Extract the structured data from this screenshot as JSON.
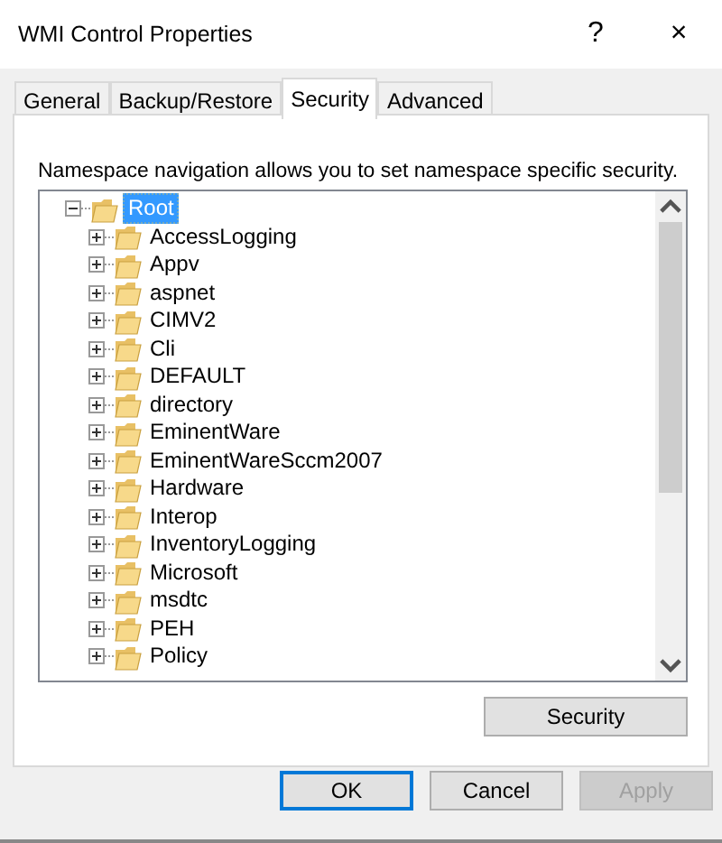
{
  "window": {
    "title": "WMI Control Properties",
    "help": "?",
    "close": "×"
  },
  "tabs": [
    {
      "label": "General",
      "selected": false
    },
    {
      "label": "Backup/Restore",
      "selected": false
    },
    {
      "label": "Security",
      "selected": true
    },
    {
      "label": "Advanced",
      "selected": false
    }
  ],
  "description": "Namespace navigation allows you to set namespace specific security.",
  "tree": {
    "label": "Root",
    "selected": true,
    "expanded": true,
    "children": [
      {
        "label": "AccessLogging",
        "selected": false,
        "expanded": false
      },
      {
        "label": "Appv",
        "selected": false,
        "expanded": false
      },
      {
        "label": "aspnet",
        "selected": false,
        "expanded": false
      },
      {
        "label": "CIMV2",
        "selected": false,
        "expanded": false
      },
      {
        "label": "Cli",
        "selected": false,
        "expanded": false
      },
      {
        "label": "DEFAULT",
        "selected": false,
        "expanded": false
      },
      {
        "label": "directory",
        "selected": false,
        "expanded": false
      },
      {
        "label": "EminentWare",
        "selected": false,
        "expanded": false
      },
      {
        "label": "EminentWareSccm2007",
        "selected": false,
        "expanded": false
      },
      {
        "label": "Hardware",
        "selected": false,
        "expanded": false
      },
      {
        "label": "Interop",
        "selected": false,
        "expanded": false
      },
      {
        "label": "InventoryLogging",
        "selected": false,
        "expanded": false
      },
      {
        "label": "Microsoft",
        "selected": false,
        "expanded": false
      },
      {
        "label": "msdtc",
        "selected": false,
        "expanded": false
      },
      {
        "label": "PEH",
        "selected": false,
        "expanded": false
      },
      {
        "label": "Policy",
        "selected": false,
        "expanded": false
      }
    ]
  },
  "security_button": {
    "label": "Security",
    "disabled": false
  },
  "buttons": [
    {
      "label": "OK",
      "default": true,
      "disabled": false
    },
    {
      "label": "Cancel",
      "default": false,
      "disabled": false
    },
    {
      "label": "Apply",
      "default": false,
      "disabled": true
    }
  ]
}
